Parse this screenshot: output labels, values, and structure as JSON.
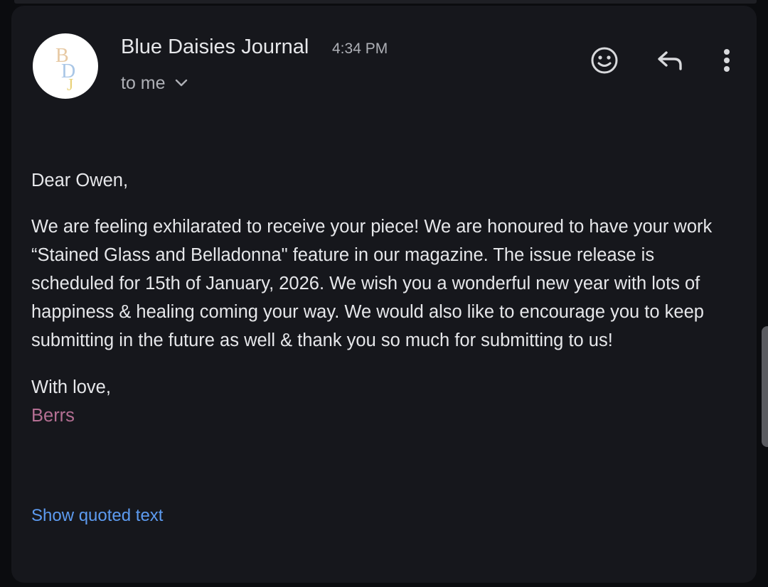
{
  "email": {
    "sender_name": "Blue Daisies Journal",
    "time": "4:34 PM",
    "recipient_label": "to me",
    "avatar_initials": "BDJ",
    "greeting": "Dear Owen,",
    "body_lines": [
      "We are feeling exhilarated to receive your piece! We are honoured to have your work",
      "“Stained Glass and Belladonna\" feature in our magazine. The issue release is",
      "scheduled for 15th of January, 2026. We wish you a wonderful new year with lots of",
      "happiness & healing coming your way. We would also like to encourage you to keep",
      "submitting in the future as well & thank you so much for submitting to us!"
    ],
    "closing": "With love,",
    "signature": "Berrs",
    "show_quoted_label": "Show quoted text"
  },
  "actions": {
    "emoji_icon": "emoji-reaction-icon",
    "reply_icon": "reply-icon",
    "more_icon": "more-vertical-icon"
  },
  "colors": {
    "background": "#0b0c0f",
    "card": "#16171c",
    "text_primary": "#e6e7ea",
    "text_secondary": "#aeb0b6",
    "signature": "#b46f93",
    "link": "#5d9bf0"
  }
}
